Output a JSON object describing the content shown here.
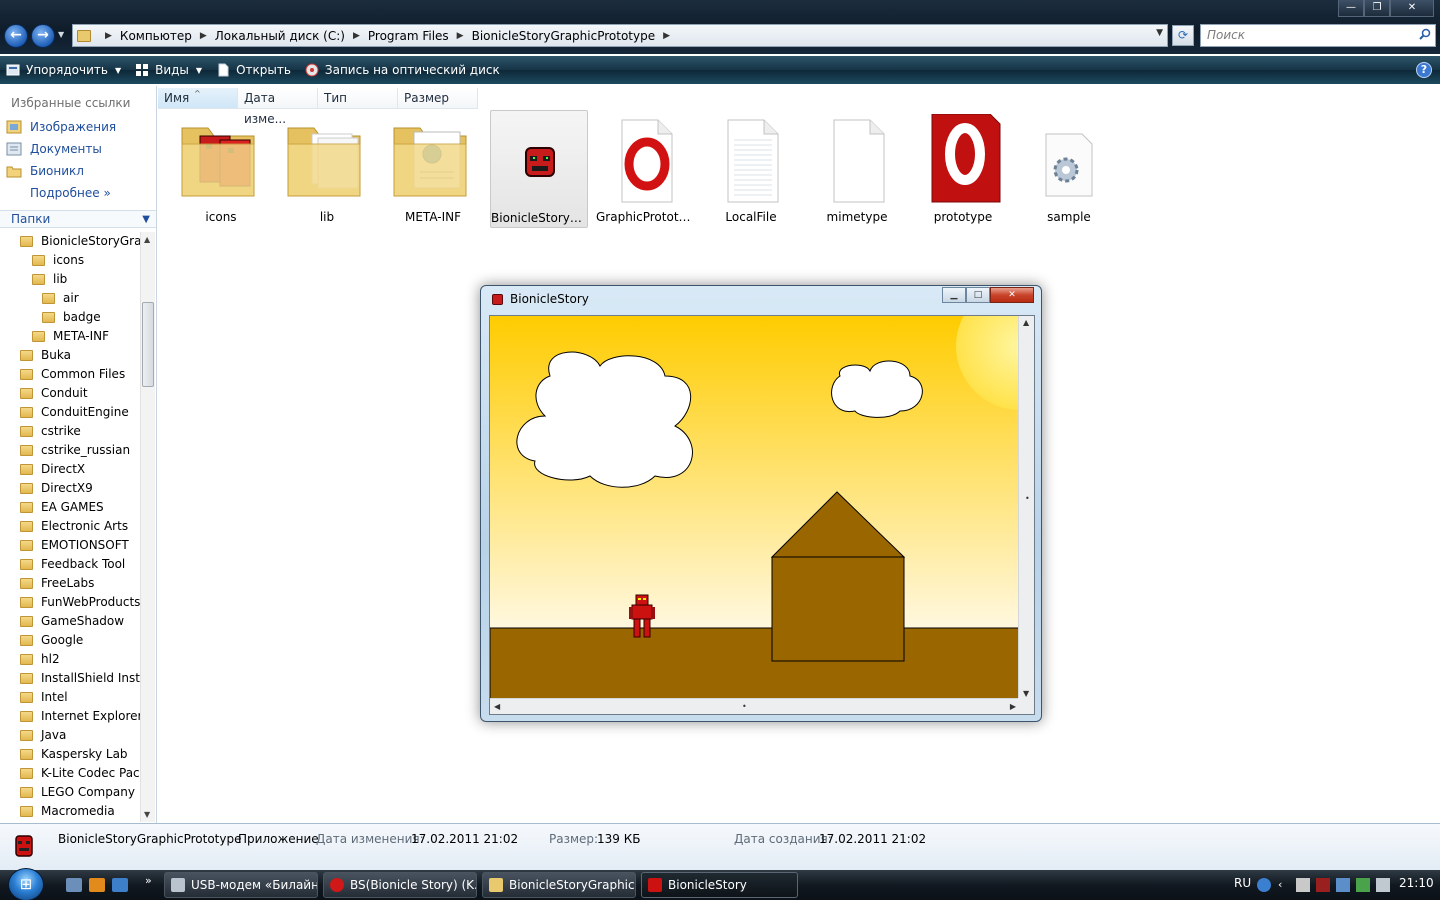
{
  "window": {
    "buttons": {
      "minimize": "—",
      "maximize": "❐",
      "close": "✕"
    }
  },
  "address": {
    "crumbs": [
      "Компьютер",
      "Локальный диск (C:)",
      "Program Files",
      "BionicleStoryGraphicPrototype"
    ]
  },
  "search": {
    "placeholder": "Поиск"
  },
  "toolbar": {
    "organize": "Упорядочить",
    "views": "Виды",
    "open": "Открыть",
    "burn": "Запись на оптический диск"
  },
  "favorites": {
    "title": "Избранные ссылки",
    "items": [
      "Изображения",
      "Документы",
      "Бионикл"
    ],
    "more": "Подробнее"
  },
  "folders": {
    "title": "Папки",
    "tree": [
      "BionicleStoryGraphicPrototype",
      "icons",
      "lib",
      "air",
      "badge",
      "META-INF",
      "Buka",
      "Common Files",
      "Conduit",
      "ConduitEngine",
      "cstrike",
      "cstrike_russian",
      "DirectX",
      "DirectX9",
      "EA GAMES",
      "Electronic Arts",
      "EMOTIONSOFT",
      "Feedback Tool",
      "FreeLabs",
      "FunWebProducts",
      "GameShadow",
      "Google",
      "hl2",
      "InstallShield Installation Information",
      "Intel",
      "Internet Explorer",
      "Java",
      "Kaspersky Lab",
      "K-Lite Codec Pack",
      "LEGO Company",
      "Macromedia"
    ]
  },
  "columns": [
    "Имя",
    "Дата изме...",
    "Тип",
    "Размер"
  ],
  "files": [
    {
      "name": "icons",
      "kind": "folder-icons"
    },
    {
      "name": "lib",
      "kind": "folder"
    },
    {
      "name": "META-INF",
      "kind": "folder-doc"
    },
    {
      "name": "BionicleStoryGraphicPrototype",
      "kind": "app"
    },
    {
      "name": "GraphicPrototype",
      "kind": "opera-doc"
    },
    {
      "name": "LocalFile",
      "kind": "text-doc"
    },
    {
      "name": "mimetype",
      "kind": "blank-doc"
    },
    {
      "name": "prototype",
      "kind": "opera-big"
    },
    {
      "name": "sample",
      "kind": "settings-doc"
    }
  ],
  "app_window": {
    "title": "BionicleStory",
    "colors": {
      "sky_top": "#ffcc00",
      "sky_bottom": "#fff8e0",
      "ground": "#996600",
      "house": "#996600",
      "sun": "#ffee66",
      "hero": "#cc1111"
    }
  },
  "details": {
    "name": "BionicleStoryGraphicPrototype",
    "type": "Приложение",
    "modified_label": "Дата изменения:",
    "modified_value": "17.02.2011 21:02",
    "size_label": "Размер:",
    "size_value": "139 КБ",
    "created_label": "Дата создания:",
    "created_value": "17.02.2011 21:02"
  },
  "taskbar": {
    "tasks": [
      "USB-модем «Билайн»",
      "BS(Bionicle Story) (K...",
      "BionicleStoryGraphicPrototype",
      "BionicleStory"
    ],
    "language": "RU",
    "clock": "21:10"
  }
}
